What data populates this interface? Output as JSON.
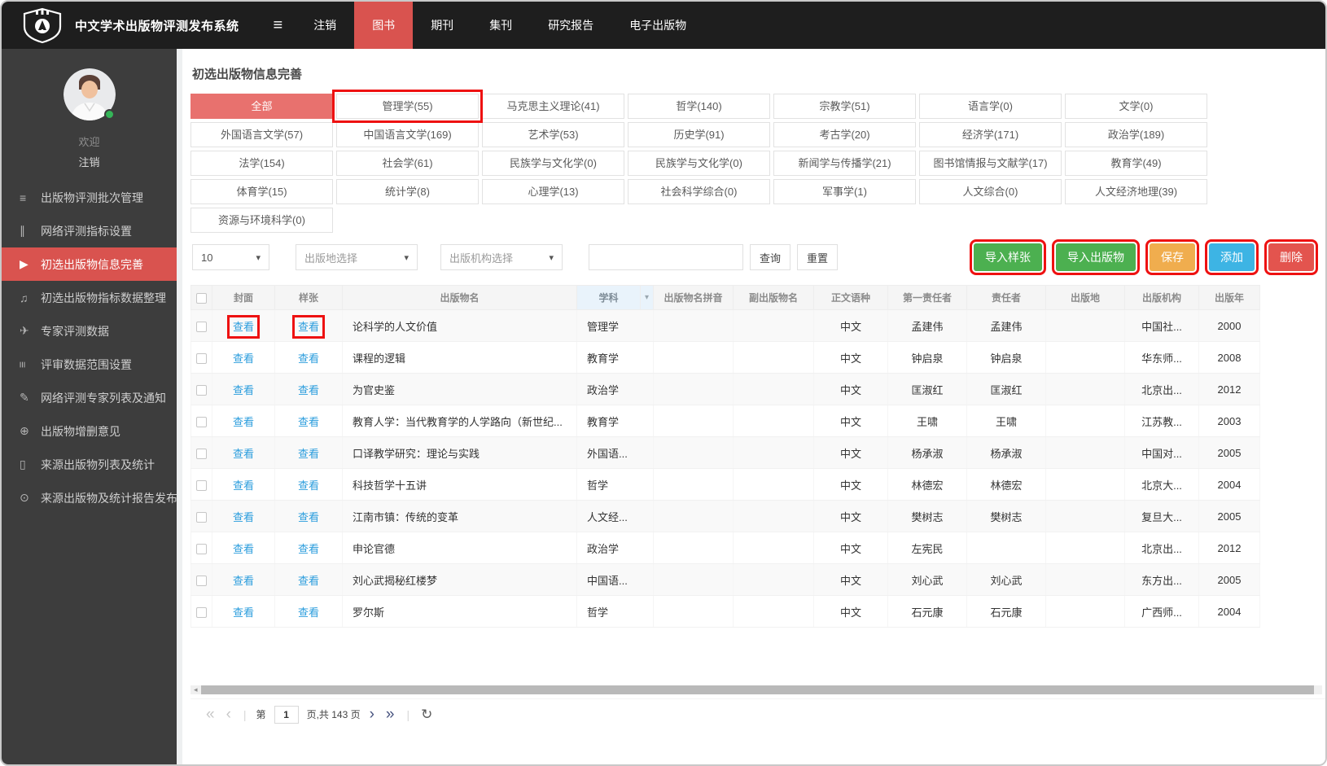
{
  "navbar": {
    "title": "中文学术出版物评测发布系统",
    "items": [
      {
        "label": "注销",
        "active": false
      },
      {
        "label": "图书",
        "active": true
      },
      {
        "label": "期刊",
        "active": false
      },
      {
        "label": "集刊",
        "active": false
      },
      {
        "label": "研究报告",
        "active": false
      },
      {
        "label": "电子出版物",
        "active": false
      }
    ]
  },
  "sidebar": {
    "welcome": "欢迎",
    "logout": "注销",
    "items": [
      {
        "label": "出版物评测批次管理",
        "icon": "list-icon",
        "glyph": "≡",
        "active": false,
        "rot": false
      },
      {
        "label": "网络评测指标设置",
        "icon": "bars-icon",
        "glyph": "∥",
        "active": false,
        "rot": false
      },
      {
        "label": "初选出版物信息完善",
        "icon": "play-icon",
        "glyph": "▶",
        "active": true,
        "rot": false
      },
      {
        "label": "初选出版物指标数据整理",
        "icon": "music-icon",
        "glyph": "♫",
        "active": false,
        "rot": false
      },
      {
        "label": "专家评测数据",
        "icon": "send-icon",
        "glyph": "✈",
        "active": false,
        "rot": false
      },
      {
        "label": "评审数据范围设置",
        "icon": "sliders-icon",
        "glyph": "≡",
        "active": false,
        "rot": true
      },
      {
        "label": "网络评测专家列表及通知",
        "icon": "paperclip-icon",
        "glyph": "✎",
        "active": false,
        "rot": false
      },
      {
        "label": "出版物增删意见",
        "icon": "search-plus-icon",
        "glyph": "⊕",
        "active": false,
        "rot": false
      },
      {
        "label": "来源出版物列表及统计",
        "icon": "book-icon",
        "glyph": "▯",
        "active": false,
        "rot": false
      },
      {
        "label": "来源出版物及统计报告发布",
        "icon": "eye-icon",
        "glyph": "⊙",
        "active": false,
        "rot": false
      }
    ]
  },
  "page": {
    "title": "初选出版物信息完善"
  },
  "categories": [
    {
      "label": "全部",
      "active": true,
      "flagged": false
    },
    {
      "label": "管理学(55)",
      "active": false,
      "flagged": true
    },
    {
      "label": "马克思主义理论(41)",
      "active": false,
      "flagged": false
    },
    {
      "label": "哲学(140)",
      "active": false,
      "flagged": false
    },
    {
      "label": "宗教学(51)",
      "active": false,
      "flagged": false
    },
    {
      "label": "语言学(0)",
      "active": false,
      "flagged": false
    },
    {
      "label": "文学(0)",
      "active": false,
      "flagged": false
    },
    {
      "label": "外国语言文学(57)",
      "active": false,
      "flagged": false
    },
    {
      "label": "中国语言文学(169)",
      "active": false,
      "flagged": false
    },
    {
      "label": "艺术学(53)",
      "active": false,
      "flagged": false
    },
    {
      "label": "历史学(91)",
      "active": false,
      "flagged": false
    },
    {
      "label": "考古学(20)",
      "active": false,
      "flagged": false
    },
    {
      "label": "经济学(171)",
      "active": false,
      "flagged": false
    },
    {
      "label": "政治学(189)",
      "active": false,
      "flagged": false
    },
    {
      "label": "法学(154)",
      "active": false,
      "flagged": false
    },
    {
      "label": "社会学(61)",
      "active": false,
      "flagged": false
    },
    {
      "label": "民族学与文化学(0)",
      "active": false,
      "flagged": false
    },
    {
      "label": "民族学与文化学(0)",
      "active": false,
      "flagged": false
    },
    {
      "label": "新闻学与传播学(21)",
      "active": false,
      "flagged": false
    },
    {
      "label": "图书馆情报与文献学(17)",
      "active": false,
      "flagged": false
    },
    {
      "label": "教育学(49)",
      "active": false,
      "flagged": false
    },
    {
      "label": "体育学(15)",
      "active": false,
      "flagged": false
    },
    {
      "label": "统计学(8)",
      "active": false,
      "flagged": false
    },
    {
      "label": "心理学(13)",
      "active": false,
      "flagged": false
    },
    {
      "label": "社会科学综合(0)",
      "active": false,
      "flagged": false
    },
    {
      "label": "军事学(1)",
      "active": false,
      "flagged": false
    },
    {
      "label": "人文综合(0)",
      "active": false,
      "flagged": false
    },
    {
      "label": "人文经济地理(39)",
      "active": false,
      "flagged": false
    },
    {
      "label": "资源与环境科学(0)",
      "active": false,
      "flagged": false
    }
  ],
  "toolbar": {
    "page_size": "10",
    "place_select": "出版地选择",
    "org_select": "出版机构选择",
    "search_value": "",
    "query": "查询",
    "reset": "重置",
    "import_sample": "导入样张",
    "import_publication": "导入出版物",
    "save": "保存",
    "add": "添加",
    "delete": "删除"
  },
  "table": {
    "columns": [
      "封面",
      "样张",
      "出版物名",
      "学科",
      "出版物名拼音",
      "副出版物名",
      "正文语种",
      "第一责任者",
      "责任者",
      "出版地",
      "出版机构",
      "出版年"
    ],
    "filter_caret": "▾",
    "rows": [
      {
        "cover": "查看",
        "sample": "查看",
        "name": "论科学的人文价值",
        "subject": "管理学",
        "pinyin": "",
        "subname": "",
        "lang": "中文",
        "author1": "孟建伟",
        "author2": "孟建伟",
        "place": "",
        "publisher": "中国社...",
        "year": "2000",
        "flagged": true
      },
      {
        "cover": "查看",
        "sample": "查看",
        "name": "课程的逻辑",
        "subject": "教育学",
        "pinyin": "",
        "subname": "",
        "lang": "中文",
        "author1": "钟启泉",
        "author2": "钟启泉",
        "place": "",
        "publisher": "华东师...",
        "year": "2008",
        "flagged": false
      },
      {
        "cover": "查看",
        "sample": "查看",
        "name": "为官史鉴",
        "subject": "政治学",
        "pinyin": "",
        "subname": "",
        "lang": "中文",
        "author1": "匡淑红",
        "author2": "匡淑红",
        "place": "",
        "publisher": "北京出...",
        "year": "2012",
        "flagged": false
      },
      {
        "cover": "查看",
        "sample": "查看",
        "name": "教育人学：当代教育学的人学路向（新世纪...",
        "subject": "教育学",
        "pinyin": "",
        "subname": "",
        "lang": "中文",
        "author1": "王啸",
        "author2": "王啸",
        "place": "",
        "publisher": "江苏教...",
        "year": "2003",
        "flagged": false
      },
      {
        "cover": "查看",
        "sample": "查看",
        "name": "口译教学研究：理论与实践",
        "subject": "外国语...",
        "pinyin": "",
        "subname": "",
        "lang": "中文",
        "author1": "杨承淑",
        "author2": "杨承淑",
        "place": "",
        "publisher": "中国对...",
        "year": "2005",
        "flagged": false
      },
      {
        "cover": "查看",
        "sample": "查看",
        "name": "科技哲学十五讲",
        "subject": "哲学",
        "pinyin": "",
        "subname": "",
        "lang": "中文",
        "author1": "林德宏",
        "author2": "林德宏",
        "place": "",
        "publisher": "北京大...",
        "year": "2004",
        "flagged": false
      },
      {
        "cover": "查看",
        "sample": "查看",
        "name": "江南市镇：传统的变革",
        "subject": "人文经...",
        "pinyin": "",
        "subname": "",
        "lang": "中文",
        "author1": "樊树志",
        "author2": "樊树志",
        "place": "",
        "publisher": "复旦大...",
        "year": "2005",
        "flagged": false
      },
      {
        "cover": "查看",
        "sample": "查看",
        "name": "申论官德",
        "subject": "政治学",
        "pinyin": "",
        "subname": "",
        "lang": "中文",
        "author1": "左宪民",
        "author2": "",
        "place": "",
        "publisher": "北京出...",
        "year": "2012",
        "flagged": false
      },
      {
        "cover": "查看",
        "sample": "查看",
        "name": "刘心武揭秘红楼梦",
        "subject": "中国语...",
        "pinyin": "",
        "subname": "",
        "lang": "中文",
        "author1": "刘心武",
        "author2": "刘心武",
        "place": "",
        "publisher": "东方出...",
        "year": "2005",
        "flagged": false
      },
      {
        "cover": "查看",
        "sample": "查看",
        "name": "罗尔斯",
        "subject": "哲学",
        "pinyin": "",
        "subname": "",
        "lang": "中文",
        "author1": "石元康",
        "author2": "石元康",
        "place": "",
        "publisher": "广西师...",
        "year": "2004",
        "flagged": false
      }
    ]
  },
  "pagination": {
    "first": "«",
    "prev": "‹",
    "page_label": "第",
    "current_page": "1",
    "total_label": "页,共 143 页",
    "next": "›",
    "last": "»",
    "refresh": "↻",
    "scroll_left": "◂"
  },
  "colors": {
    "accent_red": "#d9534f",
    "annotation_red": "#ee1111",
    "category_active": "#e8716e",
    "link_blue": "#2b9ddd",
    "button_green": "#4cb050",
    "button_orange": "#f0ad4e",
    "button_blue": "#3db4e4",
    "button_red": "#e3544e"
  }
}
